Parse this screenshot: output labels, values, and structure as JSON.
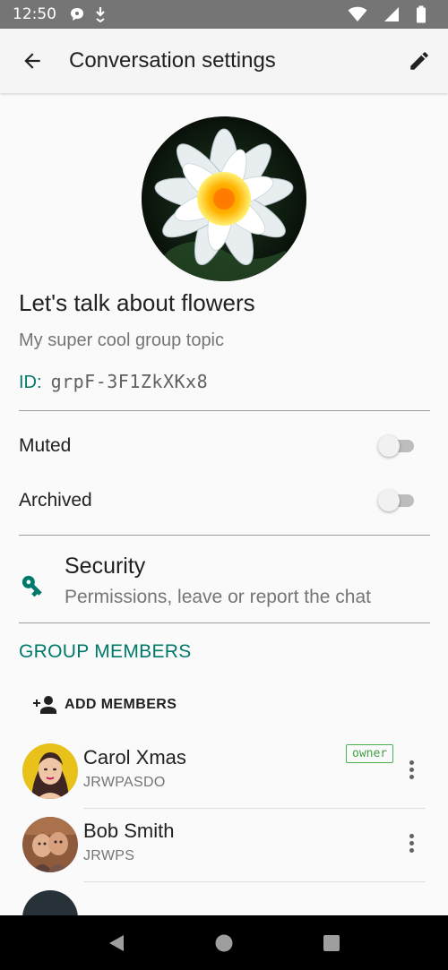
{
  "status_bar": {
    "time": "12:50",
    "icons_left": [
      "chat-bubble-icon",
      "download-icon"
    ],
    "icons_right": [
      "wifi-icon",
      "signal-icon",
      "battery-icon"
    ]
  },
  "app_bar": {
    "title": "Conversation settings",
    "back_icon": "arrow-back-icon",
    "edit_icon": "pencil-icon"
  },
  "group": {
    "name": "Let's talk about flowers",
    "topic": "My super cool group topic",
    "id_label": "ID:",
    "id_value": "grpF-3F1ZkXKx8"
  },
  "toggles": [
    {
      "label": "Muted",
      "on": false
    },
    {
      "label": "Archived",
      "on": false
    }
  ],
  "security": {
    "title": "Security",
    "subtitle": "Permissions, leave or report the chat",
    "icon": "key-icon"
  },
  "members_section": {
    "header": "GROUP MEMBERS",
    "add_label": "ADD MEMBERS",
    "add_icon": "person-add-icon",
    "members": [
      {
        "name": "Carol Xmas",
        "id": "JRWPASDO",
        "badge": "owner"
      },
      {
        "name": "Bob Smith",
        "id": "JRWPS",
        "badge": ""
      }
    ]
  },
  "colors": {
    "accent": "#00796b",
    "owner_badge": "#43a047",
    "status_bar": "#757575",
    "nav_bar": "#000000"
  },
  "nav_bar": {
    "icons": [
      "back-triangle-icon",
      "home-circle-icon",
      "recents-square-icon"
    ]
  }
}
